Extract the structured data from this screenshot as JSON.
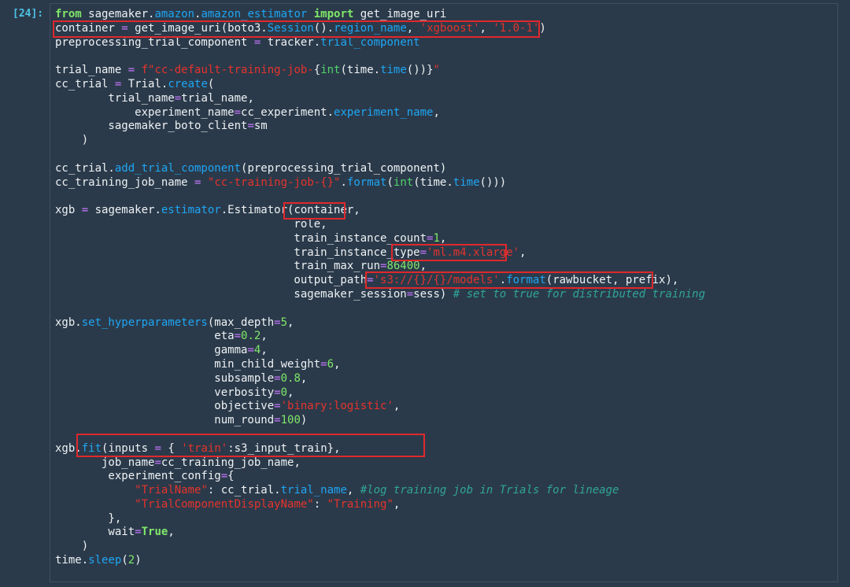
{
  "cell": {
    "prompt": "[24]:",
    "lines": [
      [
        {
          "t": "from",
          "c": "kw"
        },
        {
          "t": " sagemaker."
        },
        {
          "t": "amazon",
          "c": "attr"
        },
        {
          "t": "."
        },
        {
          "t": "amazon_estimator",
          "c": "attr"
        },
        {
          "t": " "
        },
        {
          "t": "import",
          "c": "kw"
        },
        {
          "t": " get_image_uri"
        }
      ],
      [
        {
          "t": "container "
        },
        {
          "t": "=",
          "c": "op"
        },
        {
          "t": " get_image_uri(boto3."
        },
        {
          "t": "Session",
          "c": "attr"
        },
        {
          "t": "()."
        },
        {
          "t": "region_name",
          "c": "attr"
        },
        {
          "t": ", "
        },
        {
          "t": "'xgboost'",
          "c": "str"
        },
        {
          "t": ", "
        },
        {
          "t": "'1.0-1'",
          "c": "str"
        },
        {
          "t": ")"
        }
      ],
      [
        {
          "t": "preprocessing_trial_component "
        },
        {
          "t": "=",
          "c": "op"
        },
        {
          "t": " tracker."
        },
        {
          "t": "trial_component",
          "c": "attr"
        }
      ],
      [],
      [
        {
          "t": "trial_name "
        },
        {
          "t": "=",
          "c": "op"
        },
        {
          "t": " "
        },
        {
          "t": "f\"cc-default-training-job-",
          "c": "str"
        },
        {
          "t": "{"
        },
        {
          "t": "int",
          "c": "bi"
        },
        {
          "t": "(time."
        },
        {
          "t": "time",
          "c": "attr"
        },
        {
          "t": "())}"
        },
        {
          "t": "\"",
          "c": "str"
        }
      ],
      [
        {
          "t": "cc_trial "
        },
        {
          "t": "=",
          "c": "op"
        },
        {
          "t": " Trial."
        },
        {
          "t": "create",
          "c": "attr"
        },
        {
          "t": "("
        }
      ],
      [
        {
          "t": "        trial_name"
        },
        {
          "t": "=",
          "c": "op"
        },
        {
          "t": "trial_name,"
        }
      ],
      [
        {
          "t": "            experiment_name"
        },
        {
          "t": "=",
          "c": "op"
        },
        {
          "t": "cc_experiment."
        },
        {
          "t": "experiment_name",
          "c": "attr"
        },
        {
          "t": ","
        }
      ],
      [
        {
          "t": "        sagemaker_boto_client"
        },
        {
          "t": "=",
          "c": "op"
        },
        {
          "t": "sm"
        }
      ],
      [
        {
          "t": "    )"
        }
      ],
      [],
      [
        {
          "t": "cc_trial."
        },
        {
          "t": "add_trial_component",
          "c": "attr"
        },
        {
          "t": "(preprocessing_trial_component)"
        }
      ],
      [
        {
          "t": "cc_training_job_name "
        },
        {
          "t": "=",
          "c": "op"
        },
        {
          "t": " "
        },
        {
          "t": "\"cc-training-job-{}\"",
          "c": "str"
        },
        {
          "t": "."
        },
        {
          "t": "format",
          "c": "attr"
        },
        {
          "t": "("
        },
        {
          "t": "int",
          "c": "bi"
        },
        {
          "t": "(time."
        },
        {
          "t": "time",
          "c": "attr"
        },
        {
          "t": "()))"
        }
      ],
      [],
      [
        {
          "t": "xgb "
        },
        {
          "t": "=",
          "c": "op"
        },
        {
          "t": " sagemaker."
        },
        {
          "t": "estimator",
          "c": "attr"
        },
        {
          "t": ".Estimator(container,"
        }
      ],
      [
        {
          "t": "                                    role,"
        }
      ],
      [
        {
          "t": "                                    train_instance_count"
        },
        {
          "t": "=",
          "c": "op"
        },
        {
          "t": "1",
          "c": "num"
        },
        {
          "t": ","
        }
      ],
      [
        {
          "t": "                                    train_instance_type"
        },
        {
          "t": "=",
          "c": "op"
        },
        {
          "t": "'ml.m4.xlarge'",
          "c": "str"
        },
        {
          "t": ","
        }
      ],
      [
        {
          "t": "                                    train_max_run"
        },
        {
          "t": "=",
          "c": "op"
        },
        {
          "t": "86400",
          "c": "num"
        },
        {
          "t": ","
        }
      ],
      [
        {
          "t": "                                    output_path"
        },
        {
          "t": "=",
          "c": "op"
        },
        {
          "t": "'s3://{}/{}/models'",
          "c": "str"
        },
        {
          "t": "."
        },
        {
          "t": "format",
          "c": "attr"
        },
        {
          "t": "(rawbucket, prefix),"
        }
      ],
      [
        {
          "t": "                                    sagemaker_session"
        },
        {
          "t": "=",
          "c": "op"
        },
        {
          "t": "sess) "
        },
        {
          "t": "# set to true for distributed training",
          "c": "cmt"
        }
      ],
      [],
      [
        {
          "t": "xgb."
        },
        {
          "t": "set_hyperparameters",
          "c": "attr"
        },
        {
          "t": "(max_depth"
        },
        {
          "t": "=",
          "c": "op"
        },
        {
          "t": "5",
          "c": "num"
        },
        {
          "t": ","
        }
      ],
      [
        {
          "t": "                        eta"
        },
        {
          "t": "=",
          "c": "op"
        },
        {
          "t": "0.2",
          "c": "num"
        },
        {
          "t": ","
        }
      ],
      [
        {
          "t": "                        gamma"
        },
        {
          "t": "=",
          "c": "op"
        },
        {
          "t": "4",
          "c": "num"
        },
        {
          "t": ","
        }
      ],
      [
        {
          "t": "                        min_child_weight"
        },
        {
          "t": "=",
          "c": "op"
        },
        {
          "t": "6",
          "c": "num"
        },
        {
          "t": ","
        }
      ],
      [
        {
          "t": "                        subsample"
        },
        {
          "t": "=",
          "c": "op"
        },
        {
          "t": "0.8",
          "c": "num"
        },
        {
          "t": ","
        }
      ],
      [
        {
          "t": "                        verbosity"
        },
        {
          "t": "=",
          "c": "op"
        },
        {
          "t": "0",
          "c": "num"
        },
        {
          "t": ","
        }
      ],
      [
        {
          "t": "                        objective"
        },
        {
          "t": "=",
          "c": "op"
        },
        {
          "t": "'binary:logistic'",
          "c": "str"
        },
        {
          "t": ","
        }
      ],
      [
        {
          "t": "                        num_round"
        },
        {
          "t": "=",
          "c": "op"
        },
        {
          "t": "100",
          "c": "num"
        },
        {
          "t": ")"
        }
      ],
      [],
      [
        {
          "t": "xgb."
        },
        {
          "t": "fit",
          "c": "attr"
        },
        {
          "t": "(inputs "
        },
        {
          "t": "=",
          "c": "op"
        },
        {
          "t": " { "
        },
        {
          "t": "'train'",
          "c": "str"
        },
        {
          "t": ":s3_input_train},"
        }
      ],
      [
        {
          "t": "       job_name"
        },
        {
          "t": "=",
          "c": "op"
        },
        {
          "t": "cc_training_job_name,"
        }
      ],
      [
        {
          "t": "        experiment_config"
        },
        {
          "t": "=",
          "c": "op"
        },
        {
          "t": "{"
        }
      ],
      [
        {
          "t": "            "
        },
        {
          "t": "\"TrialName\"",
          "c": "str"
        },
        {
          "t": ": cc_trial."
        },
        {
          "t": "trial_name",
          "c": "attr"
        },
        {
          "t": ", "
        },
        {
          "t": "#log training job in Trials for lineage",
          "c": "cmt"
        }
      ],
      [
        {
          "t": "            "
        },
        {
          "t": "\"TrialComponentDisplayName\"",
          "c": "str"
        },
        {
          "t": ": "
        },
        {
          "t": "\"Training\"",
          "c": "str"
        },
        {
          "t": ","
        }
      ],
      [
        {
          "t": "        },"
        }
      ],
      [
        {
          "t": "        wait"
        },
        {
          "t": "=",
          "c": "op"
        },
        {
          "t": "True",
          "c": "kw"
        },
        {
          "t": ","
        }
      ],
      [
        {
          "t": "    )"
        }
      ],
      [
        {
          "t": "time."
        },
        {
          "t": "sleep",
          "c": "attr"
        },
        {
          "t": "("
        },
        {
          "t": "2",
          "c": "num"
        },
        {
          "t": ")"
        }
      ]
    ]
  },
  "colors": {
    "background": "#2b3a4a",
    "highlight_box": "#e0282c",
    "keyword": "#7fe86a",
    "attribute": "#1ea6f4",
    "operator": "#c478ff",
    "string": "#e5332c",
    "comment": "#2fa59a"
  }
}
